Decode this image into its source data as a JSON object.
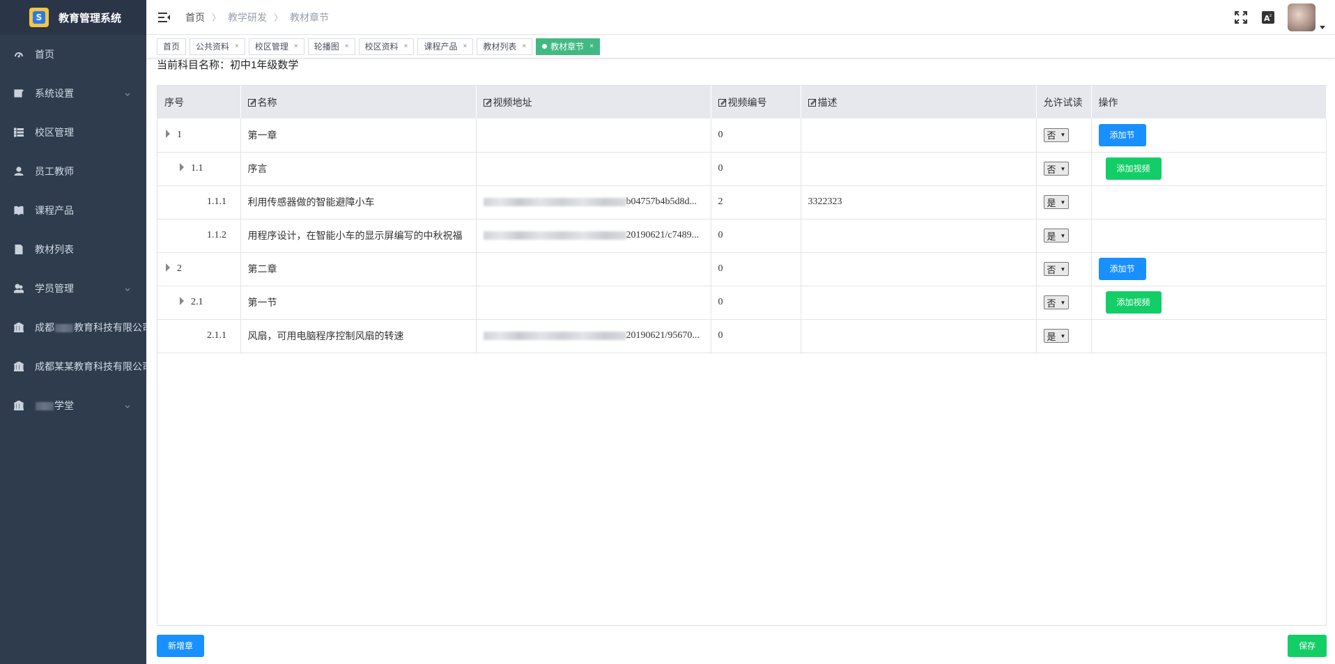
{
  "app": {
    "title": "教育管理系统",
    "logo_letter": "S"
  },
  "sidebar": {
    "items": [
      {
        "label": "首页",
        "icon": "dashboard-icon",
        "has_arrow": false
      },
      {
        "label": "系统设置",
        "icon": "settings-icon",
        "has_arrow": true
      },
      {
        "label": "校区管理",
        "icon": "list-icon",
        "has_arrow": false
      },
      {
        "label": "员工教师",
        "icon": "user-icon",
        "has_arrow": false
      },
      {
        "label": "课程产品",
        "icon": "book-icon",
        "has_arrow": false
      },
      {
        "label": "教材列表",
        "icon": "document-icon",
        "has_arrow": false
      },
      {
        "label": "学员管理",
        "icon": "users-icon",
        "has_arrow": true
      },
      {
        "label_prefix": "成都",
        "label_suffix": "教育科技有限公司",
        "icon": "bank-icon",
        "has_arrow": false
      },
      {
        "label": "成都某某教育科技有限公司",
        "icon": "bank-icon",
        "has_arrow": false
      },
      {
        "label_suffix": "学堂",
        "icon": "bank-icon",
        "has_arrow": true
      }
    ]
  },
  "header": {
    "breadcrumbs": [
      "首页",
      "教学研发",
      "教材章节"
    ],
    "separator": "〉"
  },
  "tabs": [
    {
      "label": "首页",
      "closable": false,
      "active": false
    },
    {
      "label": "公共资料",
      "closable": true,
      "active": false
    },
    {
      "label": "校区管理",
      "closable": true,
      "active": false
    },
    {
      "label": "轮播图",
      "closable": true,
      "active": false
    },
    {
      "label": "校区资料",
      "closable": true,
      "active": false
    },
    {
      "label": "课程产品",
      "closable": true,
      "active": false
    },
    {
      "label": "教材列表",
      "closable": true,
      "active": false
    },
    {
      "label": "教材章节",
      "closable": true,
      "active": true
    }
  ],
  "tab_close_glyph": "×",
  "main": {
    "subject_label": "当前科目名称：",
    "subject_value": "初中1年级数学"
  },
  "table": {
    "columns": [
      "序号",
      "名称",
      "视频地址",
      "视频编号",
      "描述",
      "允许试读",
      "操作"
    ],
    "rows": [
      {
        "level": 1,
        "index": "1",
        "name": "第一章",
        "url_tail": "",
        "video_no": "0",
        "desc": "",
        "trial": "否",
        "action": "添加节"
      },
      {
        "level": 2,
        "index": "1.1",
        "name": "序言",
        "url_tail": "",
        "video_no": "0",
        "desc": "",
        "trial": "否",
        "action": "添加视频"
      },
      {
        "level": 3,
        "index": "1.1.1",
        "name": "利用传感器做的智能避障小车",
        "url_tail": "b04757b4b5d8d...",
        "video_no": "2",
        "desc": "3322323",
        "trial": "是",
        "action": ""
      },
      {
        "level": 3,
        "index": "1.1.2",
        "name": "用程序设计，在智能小车的显示屏编写的中秋祝福",
        "url_tail": "20190621/c7489...",
        "video_no": "0",
        "desc": "",
        "trial": "是",
        "action": ""
      },
      {
        "level": 1,
        "index": "2",
        "name": "第二章",
        "url_tail": "",
        "video_no": "0",
        "desc": "",
        "trial": "否",
        "action": "添加节"
      },
      {
        "level": 2,
        "index": "2.1",
        "name": "第一节",
        "url_tail": "",
        "video_no": "0",
        "desc": "",
        "trial": "否",
        "action": "添加视频"
      },
      {
        "level": 3,
        "index": "2.1.1",
        "name": "风扇，可用电脑程序控制风扇的转速",
        "url_tail": "20190621/95670...",
        "video_no": "0",
        "desc": "",
        "trial": "是",
        "action": ""
      }
    ]
  },
  "footer": {
    "add_chapter": "新增章",
    "save": "保存"
  },
  "colors": {
    "sidebar_bg": "#2f3c4e",
    "active_tab": "#42b983",
    "primary": "#1890ff",
    "success": "#13ce66"
  }
}
